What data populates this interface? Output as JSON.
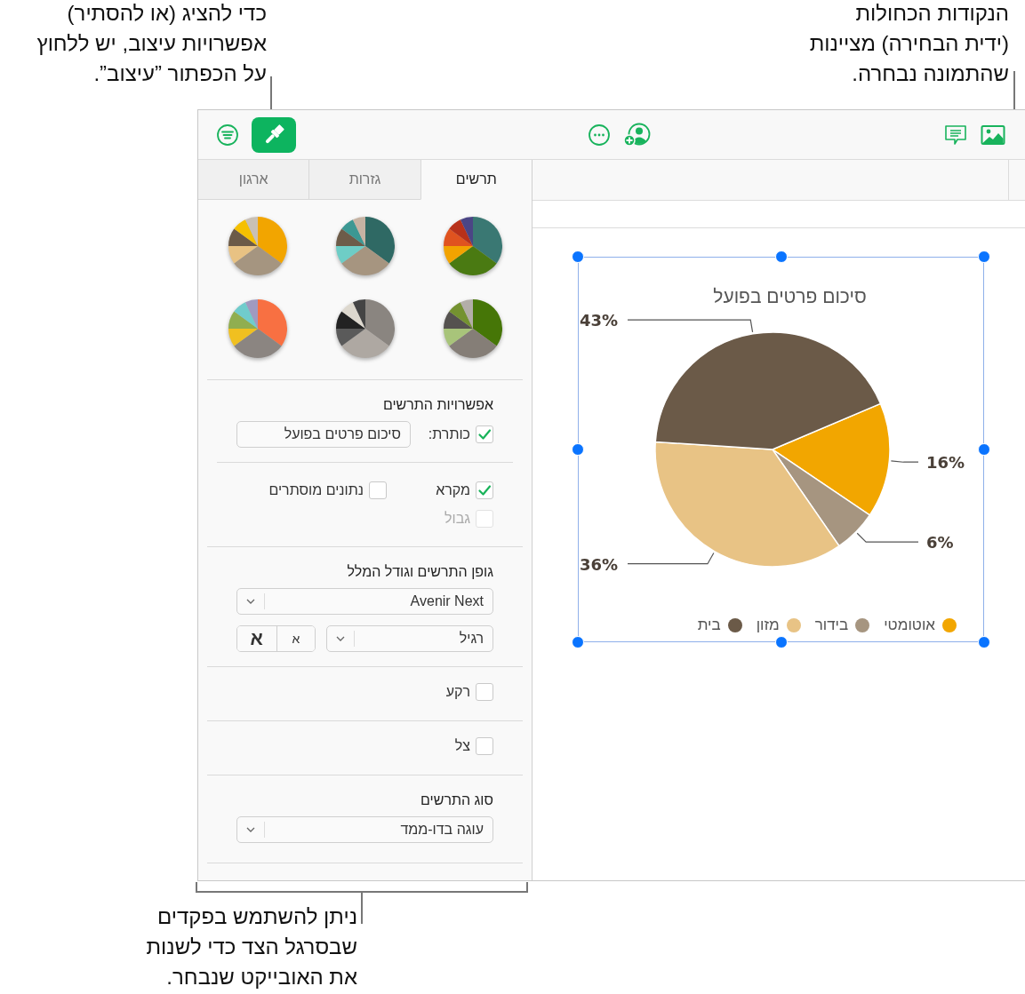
{
  "callouts": [
    {
      "text": "הנקודות הכחולות (ידית הבחירה) מציינות שהתמונה נבחרה."
    },
    {
      "text": "כדי להציג (או להסתיר) אפשרויות עיצוב, יש ללחוץ על הכפתור ”עיצוב”."
    },
    {
      "text": "ניתן להשתמש בפקדים שבסרגל הצד כדי לשנות את האובייקט שנבחר."
    }
  ],
  "toolbar": {
    "format_selected": true
  },
  "sidebar": {
    "tabs": [
      {
        "label": "תרשים",
        "selected": true
      },
      {
        "label": "גזרות",
        "selected": false
      },
      {
        "label": "ארגון",
        "selected": false
      }
    ],
    "chart_options": {
      "heading": "אפשרויות התרשים",
      "title": {
        "label": "כותרת:",
        "checked": true,
        "disabled": false,
        "value": "סיכום פרטים בפועל"
      },
      "legend": {
        "label": "מקרא",
        "checked": true,
        "disabled": false
      },
      "hidden_data": {
        "label": "נתונים מוסתרים",
        "checked": false,
        "disabled": false
      },
      "border": {
        "label": "גבול",
        "checked": false,
        "disabled": true
      }
    },
    "font": {
      "heading": "גופן התרשים וגודל המלל",
      "family": "Avenir Next",
      "style": "רגיל",
      "smaller": "א",
      "larger": "א"
    },
    "background": {
      "label": "רקע",
      "checked": false,
      "disabled": false
    },
    "shadow": {
      "label": "צל",
      "checked": false,
      "disabled": false
    },
    "chart_type": {
      "heading": "סוג התרשים",
      "value": "עוגה בדו-ממד"
    }
  },
  "chart": {
    "selected": true,
    "chart_data": {
      "type": "pie",
      "title": "סיכום פרטים בפועל",
      "categories": [
        "אוטומטי",
        "בידור",
        "מזון",
        "בית"
      ],
      "series": [
        {
          "values": [
            16,
            6,
            36,
            43
          ]
        }
      ],
      "colors": [
        "#f2a600",
        "#a69580",
        "#e8c385",
        "#6b5a48"
      ],
      "value_labels": [
        "16%",
        "6%",
        "36%",
        "43%"
      ],
      "legend": "bottom"
    }
  }
}
